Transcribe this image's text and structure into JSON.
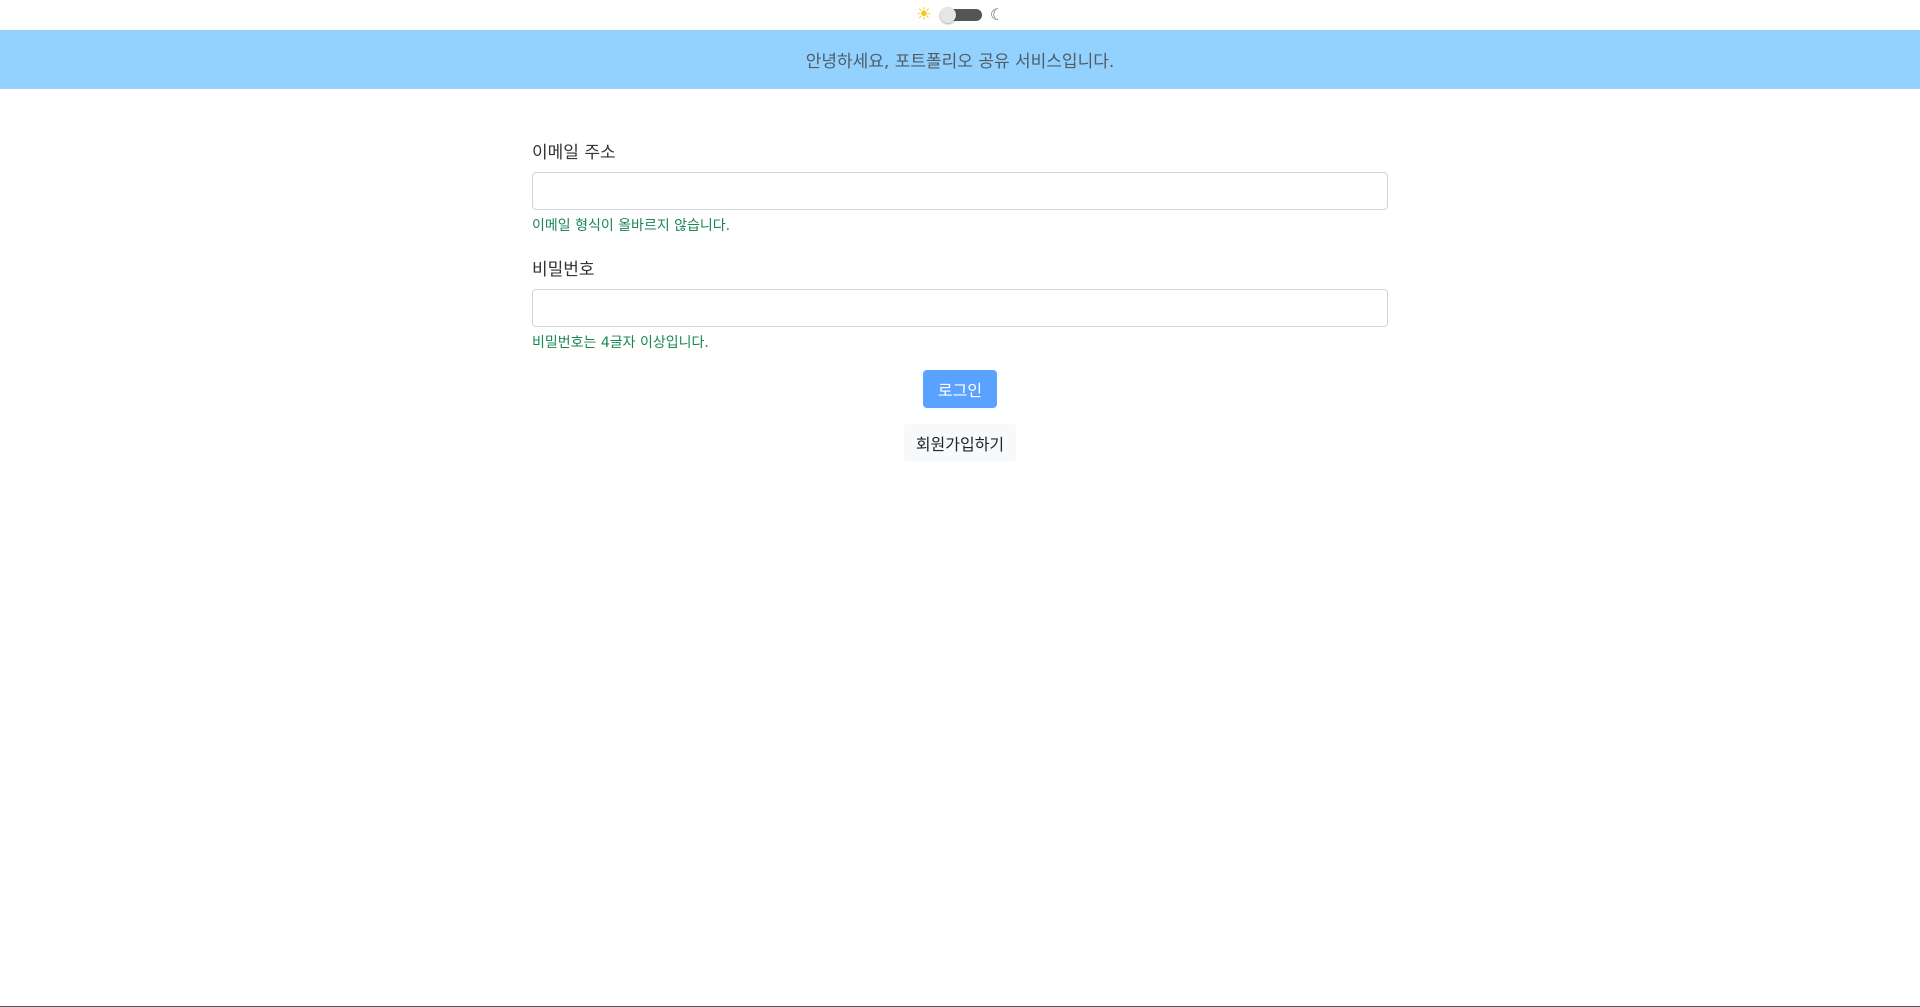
{
  "theme_toggle": {
    "light_icon": "sun-icon",
    "dark_icon": "moon-icon",
    "light_glyph": "☀",
    "dark_glyph": "☾"
  },
  "banner": {
    "text": "안녕하세요, 포트폴리오 공유 서비스입니다."
  },
  "form": {
    "email": {
      "label": "이메일 주소",
      "value": "",
      "placeholder": "",
      "hint": "이메일 형식이 올바르지 않습니다."
    },
    "password": {
      "label": "비밀번호",
      "value": "",
      "placeholder": "",
      "hint": "비밀번호는 4글자 이상입니다."
    },
    "login_label": "로그인",
    "signup_label": "회원가입하기"
  },
  "colors": {
    "banner_bg": "#93d1ff",
    "hint_text": "#198754",
    "primary_button": "#5aa2ff"
  }
}
